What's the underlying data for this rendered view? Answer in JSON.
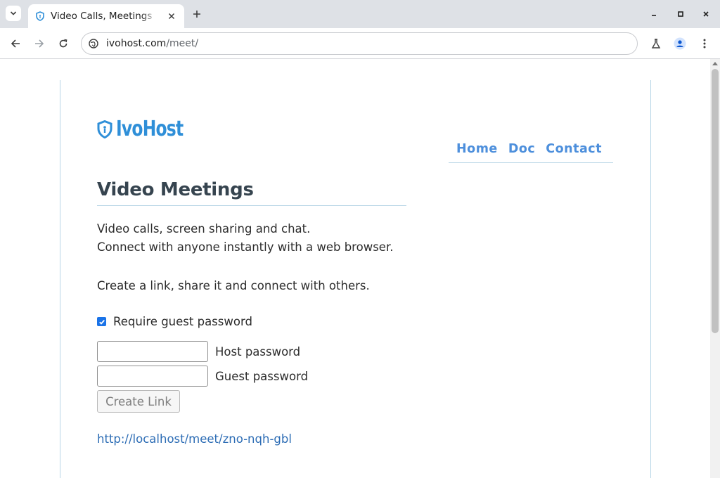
{
  "browser": {
    "tab": {
      "title": "Video Calls, Meetings"
    },
    "url": {
      "host": "ivohost.com",
      "path": "/meet/"
    }
  },
  "page": {
    "logo_text": "IvoHost",
    "nav": [
      {
        "label": "Home"
      },
      {
        "label": "Doc"
      },
      {
        "label": "Contact"
      }
    ],
    "heading": "Video Meetings",
    "intro_line1": "Video calls, screen sharing and chat.",
    "intro_line2": "Connect with anyone instantly with a web browser.",
    "instruction": "Create a link, share it and connect with others.",
    "require_password": {
      "label": "Require guest password",
      "checked": true
    },
    "host_password": {
      "label": "Host password",
      "value": ""
    },
    "guest_password": {
      "label": "Guest password",
      "value": ""
    },
    "create_button": "Create Link",
    "meeting_link": "http://localhost/meet/zno-nqh-gbl"
  },
  "colors": {
    "brand": "#2f8fd8",
    "nav_link": "#4d8fdc",
    "heading": "#36444f",
    "link": "#2d6db5",
    "checkbox": "#1a73e8"
  },
  "icons": {
    "tab_favicon": "shield-icon",
    "site_info": "site-info-icon",
    "logo": "shield-icon"
  }
}
